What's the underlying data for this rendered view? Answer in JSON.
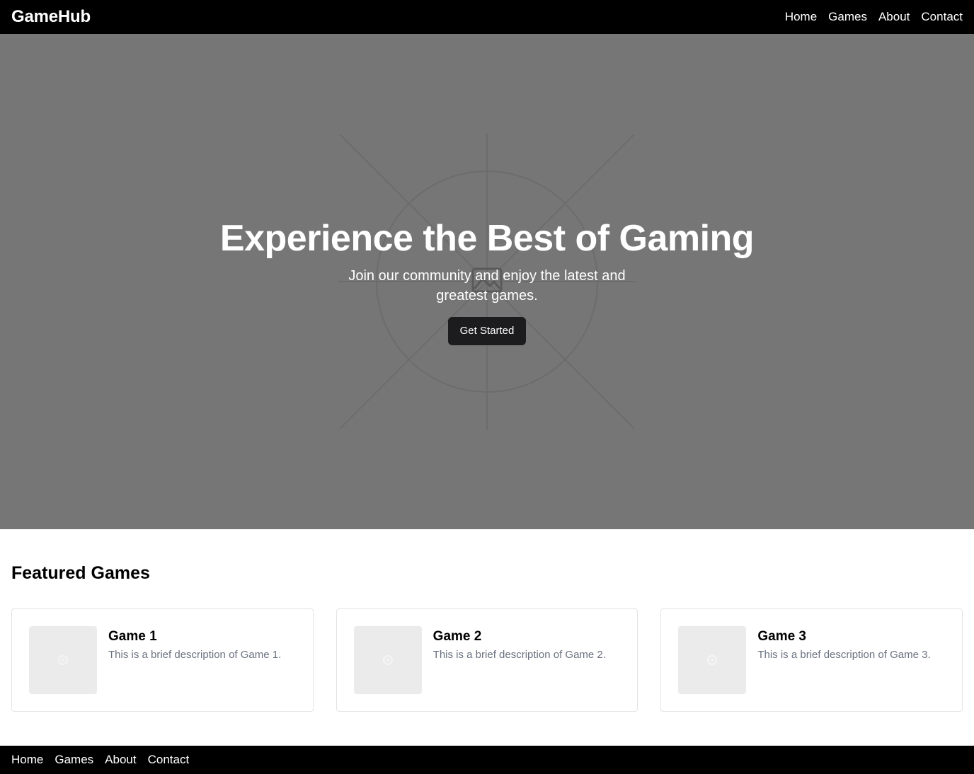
{
  "header": {
    "brand": "GameHub",
    "nav": [
      "Home",
      "Games",
      "About",
      "Contact"
    ]
  },
  "hero": {
    "title": "Experience the Best of Gaming",
    "subtitle": "Join our community and enjoy the latest and greatest games.",
    "cta_label": "Get Started",
    "background_color": "#767676"
  },
  "featured": {
    "heading": "Featured Games",
    "games": [
      {
        "title": "Game 1",
        "description": "This is a brief description of Game 1.",
        "image_icon": "image-placeholder-icon"
      },
      {
        "title": "Game 2",
        "description": "This is a brief description of Game 2.",
        "image_icon": "image-placeholder-icon"
      },
      {
        "title": "Game 3",
        "description": "This is a brief description of Game 3.",
        "image_icon": "image-placeholder-icon"
      }
    ]
  },
  "footer": {
    "nav": [
      "Home",
      "Games",
      "About",
      "Contact"
    ]
  },
  "colors": {
    "header_bg": "#000000",
    "footer_bg": "#000000",
    "cta_bg": "#1c1c1e",
    "card_border": "#e4e4e7",
    "description_text": "#6b7280"
  }
}
